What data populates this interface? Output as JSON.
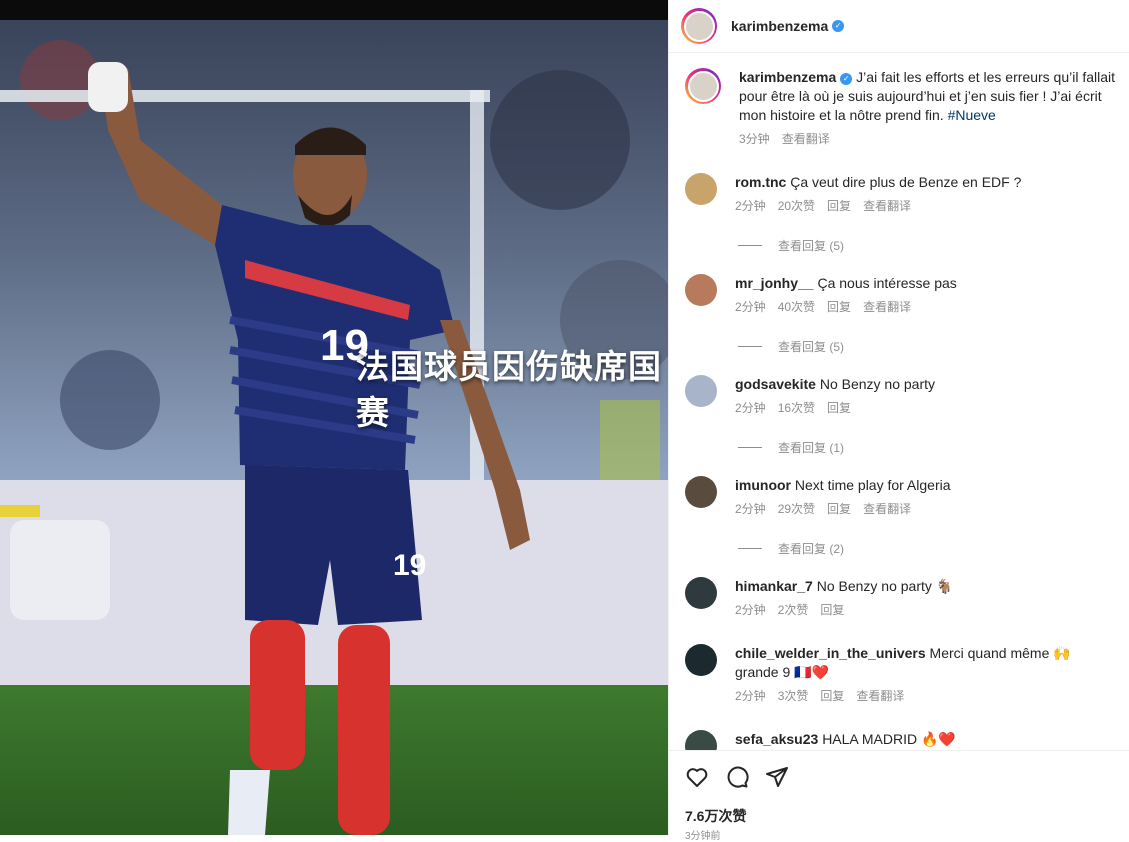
{
  "overlay_title": "法国球员因伤缺席国赛",
  "post": {
    "username": "karimbenzema",
    "caption": "J’ai fait les efforts et les erreurs qu’il fallait pour être là où je suis aujourd’hui et j’en suis fier ! J’ai écrit mon histoire et la nôtre prend fin.",
    "hashtag": "#Nueve",
    "time": "3分钟",
    "translate": "查看翻译"
  },
  "comments": [
    {
      "user": "rom.tnc",
      "text": "Ça veut dire plus de Benze en EDF ?",
      "time": "2分钟",
      "likes": "20次赞",
      "reply": "回复",
      "translate": "查看翻译",
      "view_replies": "查看回复 (5)",
      "avatar_color": "#c8a46a"
    },
    {
      "user": "mr_jonhy__",
      "text": "Ça nous intéresse pas",
      "time": "2分钟",
      "likes": "40次赞",
      "reply": "回复",
      "translate": "查看翻译",
      "view_replies": "查看回复 (5)",
      "avatar_color": "#b87a5c"
    },
    {
      "user": "godsavekite",
      "text": "No Benzy no party",
      "time": "2分钟",
      "likes": "16次赞",
      "reply": "回复",
      "translate": "",
      "view_replies": "查看回复 (1)",
      "avatar_color": "#a7b4c9"
    },
    {
      "user": "imunoor",
      "text": "Next time play for Algeria",
      "time": "2分钟",
      "likes": "29次赞",
      "reply": "回复",
      "translate": "查看翻译",
      "view_replies": "查看回复 (2)",
      "avatar_color": "#5a4b3f"
    },
    {
      "user": "himankar_7",
      "text": "No Benzy no party 🐐",
      "time": "2分钟",
      "likes": "2次赞",
      "reply": "回复",
      "translate": "",
      "view_replies": "",
      "avatar_color": "#2f3a3f"
    },
    {
      "user": "chile_welder_in_the_univers",
      "text": "Merci quand même 🙌 grande 9 🇫🇷❤️",
      "time": "2分钟",
      "likes": "3次赞",
      "reply": "回复",
      "translate": "查看翻译",
      "view_replies": "",
      "avatar_color": "#1c2a30"
    },
    {
      "user": "sefa_aksu23",
      "text": "HALA MADRID 🔥❤️",
      "time": "",
      "likes": "",
      "reply": "",
      "translate": "",
      "view_replies": "",
      "avatar_color": "#3a4a44"
    }
  ],
  "footer": {
    "likes": "7.6万次赞",
    "time": "3分钟前"
  },
  "icons": [
    "heart-icon",
    "comment-icon",
    "share-icon",
    "verified-badge-icon"
  ]
}
